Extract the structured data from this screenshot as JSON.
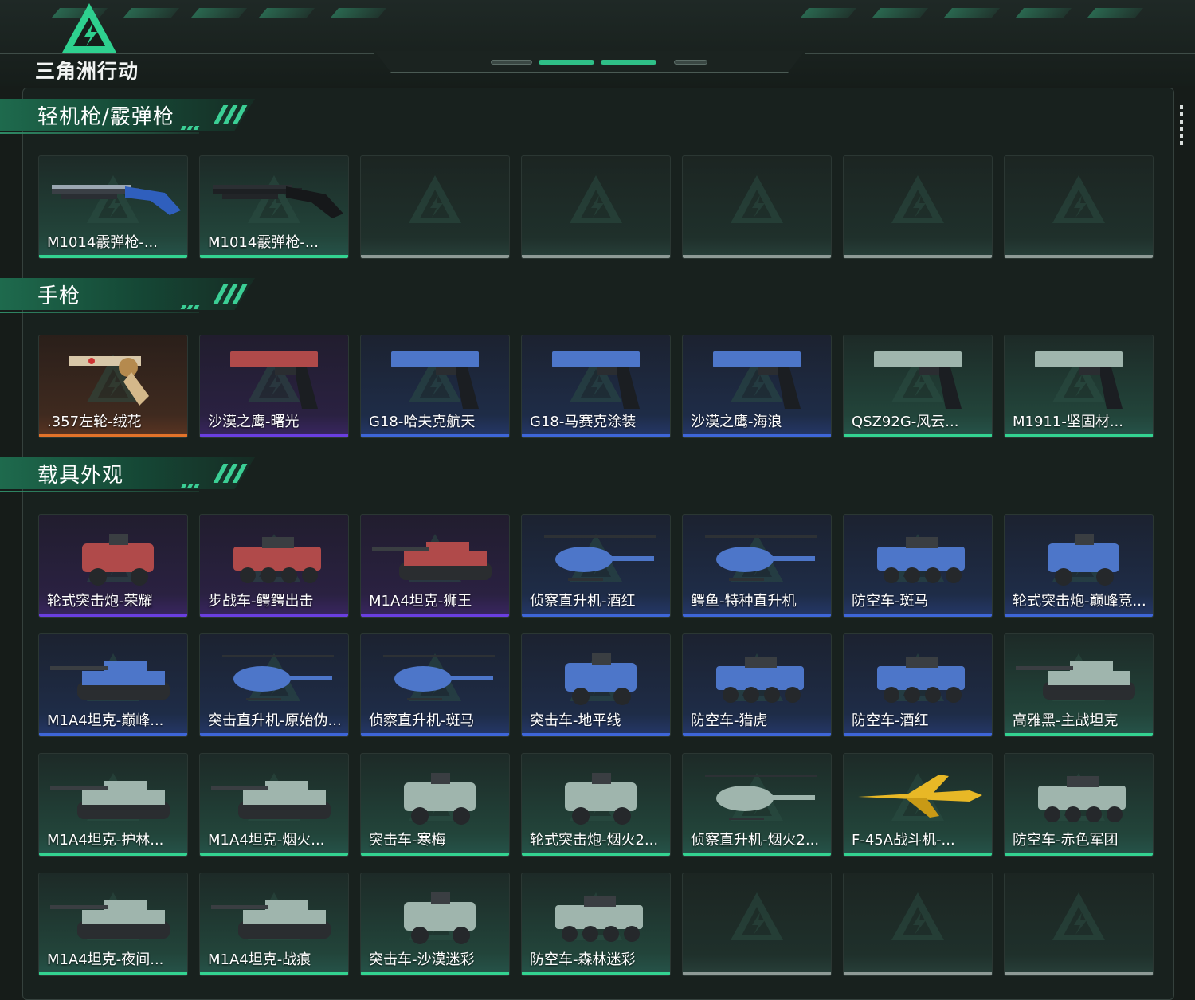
{
  "app": {
    "logo_text": "三角洲行动"
  },
  "sections": [
    {
      "title": "轻机枪/霰弹枪",
      "items": [
        {
          "label": "M1014霰弹枪-...",
          "rarity": "green",
          "icon": "shotgun-blue-icon"
        },
        {
          "label": "M1014霰弹枪-...",
          "rarity": "green",
          "icon": "shotgun-black-icon"
        },
        {
          "label": "",
          "rarity": "empty",
          "icon": "delta-logo-icon"
        },
        {
          "label": "",
          "rarity": "empty",
          "icon": "delta-logo-icon"
        },
        {
          "label": "",
          "rarity": "empty",
          "icon": "delta-logo-icon"
        },
        {
          "label": "",
          "rarity": "empty",
          "icon": "delta-logo-icon"
        },
        {
          "label": "",
          "rarity": "empty",
          "icon": "delta-logo-icon"
        }
      ]
    },
    {
      "title": "手枪",
      "items": [
        {
          "label": ".357左轮-绒花",
          "rarity": "orange",
          "icon": "revolver-icon"
        },
        {
          "label": "沙漠之鹰-曙光",
          "rarity": "purple",
          "icon": "pistol-icon"
        },
        {
          "label": "G18-哈夫克航天",
          "rarity": "blue",
          "icon": "pistol-icon"
        },
        {
          "label": "G18-马赛克涂装",
          "rarity": "blue",
          "icon": "pistol-icon"
        },
        {
          "label": "沙漠之鹰-海浪",
          "rarity": "blue",
          "icon": "pistol-icon"
        },
        {
          "label": "QSZ92G-风云...",
          "rarity": "green",
          "icon": "pistol-icon"
        },
        {
          "label": "M1911-坚固材...",
          "rarity": "green",
          "icon": "pistol-icon"
        }
      ]
    },
    {
      "title": "载具外观",
      "items": [
        {
          "label": "轮式突击炮-荣耀",
          "rarity": "purple",
          "icon": "armored-car-icon"
        },
        {
          "label": "步战车-鳄鳄出击",
          "rarity": "purple",
          "icon": "ifv-icon"
        },
        {
          "label": "M1A4坦克-狮王",
          "rarity": "purple",
          "icon": "tank-icon"
        },
        {
          "label": "侦察直升机-酒红",
          "rarity": "blue",
          "icon": "helicopter-icon"
        },
        {
          "label": "鳄鱼-特种直升机",
          "rarity": "blue",
          "icon": "helicopter-icon"
        },
        {
          "label": "防空车-斑马",
          "rarity": "blue",
          "icon": "ifv-icon"
        },
        {
          "label": "轮式突击炮-巅峰竞...",
          "rarity": "blue",
          "icon": "armored-car-icon"
        },
        {
          "label": "M1A4坦克-巅峰...",
          "rarity": "blue",
          "icon": "tank-icon"
        },
        {
          "label": "突击直升机-原始伪...",
          "rarity": "blue",
          "icon": "helicopter-icon"
        },
        {
          "label": "侦察直升机-斑马",
          "rarity": "blue",
          "icon": "helicopter-icon"
        },
        {
          "label": "突击车-地平线",
          "rarity": "blue",
          "icon": "armored-car-icon"
        },
        {
          "label": "防空车-猎虎",
          "rarity": "blue",
          "icon": "ifv-icon"
        },
        {
          "label": "防空车-酒红",
          "rarity": "blue",
          "icon": "ifv-icon"
        },
        {
          "label": "高雅黑-主战坦克",
          "rarity": "green",
          "icon": "tank-icon"
        },
        {
          "label": "M1A4坦克-护林...",
          "rarity": "green",
          "icon": "tank-icon"
        },
        {
          "label": "M1A4坦克-烟火...",
          "rarity": "green",
          "icon": "tank-icon"
        },
        {
          "label": "突击车-寒梅",
          "rarity": "green",
          "icon": "armored-car-icon"
        },
        {
          "label": "轮式突击炮-烟火2...",
          "rarity": "green",
          "icon": "armored-car-icon"
        },
        {
          "label": "侦察直升机-烟火2...",
          "rarity": "green",
          "icon": "helicopter-icon"
        },
        {
          "label": "F-45A战斗机-...",
          "rarity": "green",
          "icon": "jet-icon"
        },
        {
          "label": "防空车-赤色军团",
          "rarity": "green",
          "icon": "ifv-icon"
        },
        {
          "label": "M1A4坦克-夜间...",
          "rarity": "green",
          "icon": "tank-icon"
        },
        {
          "label": "M1A4坦克-战痕",
          "rarity": "green",
          "icon": "tank-icon"
        },
        {
          "label": "突击车-沙漠迷彩",
          "rarity": "green",
          "icon": "armored-car-icon"
        },
        {
          "label": "防空车-森林迷彩",
          "rarity": "green",
          "icon": "ifv-icon"
        },
        {
          "label": "",
          "rarity": "empty",
          "icon": "delta-logo-icon"
        },
        {
          "label": "",
          "rarity": "empty",
          "icon": "delta-logo-icon"
        },
        {
          "label": "",
          "rarity": "empty",
          "icon": "delta-logo-icon"
        }
      ]
    }
  ],
  "colors": {
    "accent": "#33d391",
    "rarity_green": "#33d391",
    "rarity_blue": "#3e66d8",
    "rarity_purple": "#6a3fe0",
    "rarity_orange": "#e2732a",
    "empty": "#8e9a96"
  }
}
